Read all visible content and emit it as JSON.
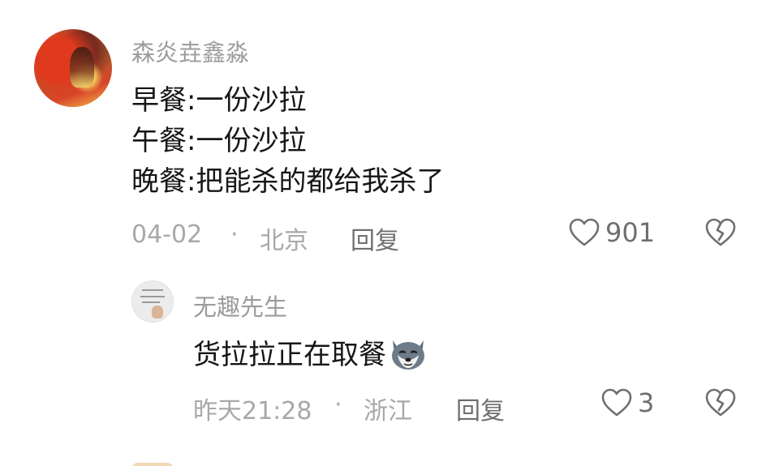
{
  "comment": {
    "username": "森炎垚鑫淼",
    "lines": [
      "早餐:一份沙拉",
      "午餐:一份沙拉",
      "晚餐:把能杀的都给我杀了"
    ],
    "date": "04-02",
    "separator": "·",
    "location": "北京",
    "reply_label": "回复",
    "like_count": "901"
  },
  "reply": {
    "username": "无趣先生",
    "text": "货拉拉正在取餐",
    "emoji": "husky-dog-emoji",
    "date": "昨天21:28",
    "separator": "·",
    "location": "浙江",
    "reply_label": "回复",
    "like_count": "3"
  },
  "icons": {
    "like": "heart-outline-icon",
    "dislike": "broken-heart-icon"
  },
  "colors": {
    "username": "#9c9c9c",
    "content": "#161616",
    "meta": "#a8a8a8",
    "action": "#6f6f6f"
  }
}
